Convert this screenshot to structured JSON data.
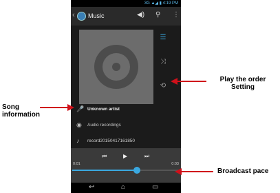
{
  "statusbar": {
    "text": "3G ▲◢ ▮ 4:19 PM"
  },
  "actionbar": {
    "back": "‹",
    "title": "Music",
    "volume_icon": "◀)",
    "search_icon": "⚲",
    "menu_icon": "⋮"
  },
  "side": {
    "queue_icon": "☰",
    "shuffle_icon": "⤨",
    "repeat_icon": "⟲"
  },
  "info": {
    "artist": "Unknown artist",
    "album": "Audio recordings",
    "track": "record20150417161850",
    "artist_icon": "🎤",
    "album_icon": "◉",
    "track_icon": "♪"
  },
  "player": {
    "prev_icon": "⏮",
    "play_icon": "▶",
    "next_icon": "⏭",
    "elapsed": "0:01",
    "total": "0:03",
    "progress": 0.6
  },
  "nav": {
    "back_icon": "↩",
    "home_icon": "⌂",
    "recents_icon": "▭"
  },
  "callouts": {
    "order_setting": [
      "Play the order",
      "Setting"
    ],
    "song_info": [
      "Song",
      "information"
    ],
    "broadcast_pace": "Broadcast pace"
  },
  "colors": {
    "accent": "#3aa8e0",
    "arrow": "#d0101a"
  }
}
